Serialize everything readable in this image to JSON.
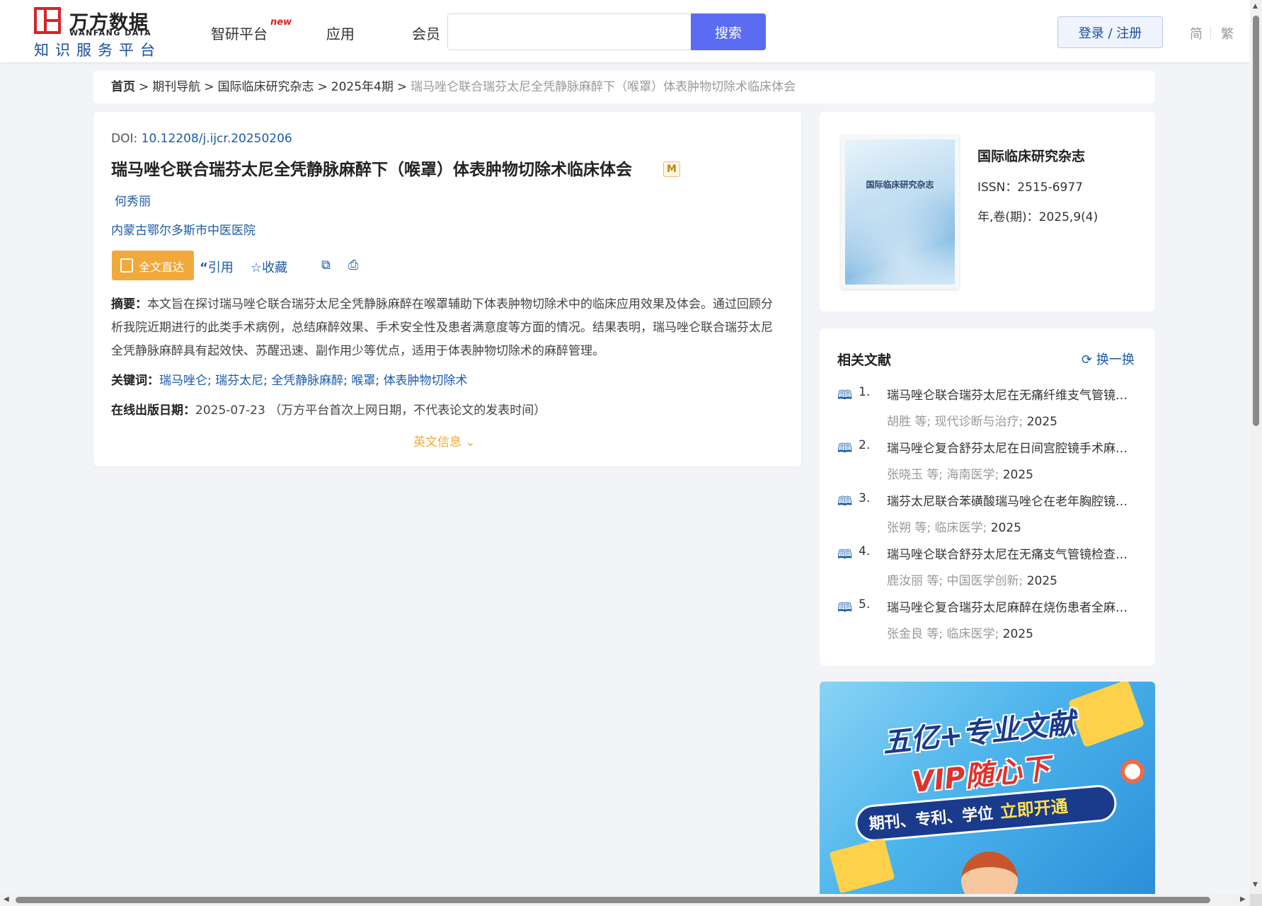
{
  "header": {
    "logo_cn": "万方数据",
    "logo_en": "WANFANG DATA",
    "logo_sub": "知识服务平台",
    "nav": [
      {
        "label": "智研平台",
        "badge": "new"
      },
      {
        "label": "应用"
      },
      {
        "label": "会员"
      }
    ],
    "search": {
      "value": "",
      "placeholder": "",
      "button": "搜索"
    },
    "login": "登录 / 注册",
    "lang_simplified": "简",
    "lang_traditional": "繁"
  },
  "breadcrumb": {
    "items": [
      "首页",
      "期刊导航",
      "国际临床研究杂志",
      "2025年4期"
    ],
    "current": "瑞马唑仑联合瑞芬太尼全凭静脉麻醉下（喉罩）体表肿物切除术临床体会",
    "separator": ">"
  },
  "article": {
    "doi_label": "DOI: ",
    "doi": "10.12208/j.ijcr.20250206",
    "title": "瑞马唑仑联合瑞芬太尼全凭静脉麻醉下（喉罩）体表肿物切除术临床体会",
    "badge": "M",
    "author": "何秀丽",
    "organization": "内蒙古鄂尔多斯市中医医院",
    "actions": {
      "fulltext": "全文直达",
      "cite": "引用",
      "collect": "收藏"
    },
    "abstract_label": "摘要：",
    "abstract": "本文旨在探讨瑞马唑仑联合瑞芬太尼全凭静脉麻醉在喉罩辅助下体表肿物切除术中的临床应用效果及体会。通过回顾分析我院近期进行的此类手术病例，总结麻醉效果、手术安全性及患者满意度等方面的情况。结果表明，瑞马唑仑联合瑞芬太尼全凭静脉麻醉具有起效快、苏醒迅速、副作用少等优点，适用于体表肿物切除术的麻醉管理。",
    "keywords_label": "关键词：",
    "keywords": [
      "瑞马唑仑",
      "瑞芬太尼",
      "全凭静脉麻醉",
      "喉罩",
      "体表肿物切除术"
    ],
    "pubdate_label": "在线出版日期：",
    "pubdate": "2025-07-23",
    "pubdate_note": "（万方平台首次上网日期，不代表论文的发表时间）",
    "english_info": "英文信息"
  },
  "journal": {
    "cover_title": "国际临床研究杂志",
    "name": "国际临床研究杂志",
    "issn": "ISSN：2515-6977",
    "volume": "年,卷(期)：2025,9(4)"
  },
  "related": {
    "title": "相关文献",
    "refresh": "换一换",
    "items": [
      {
        "num": "1.",
        "title": "瑞马唑仑联合瑞芬太尼在无痛纤维支气管镜检查中的应用",
        "author": "胡胜",
        "journal": "现代诊断与治疗",
        "year": "2025"
      },
      {
        "num": "2.",
        "title": "瑞马唑仑复合舒芬太尼在日间宫腔镜手术麻醉中的应用",
        "author": "张晓玉",
        "journal": "海南医学",
        "year": "2025"
      },
      {
        "num": "3.",
        "title": "瑞芬太尼联合苯磺酸瑞马唑仑在老年胸腔镜手术中的应用",
        "author": "张朔",
        "journal": "临床医学",
        "year": "2025"
      },
      {
        "num": "4.",
        "title": "瑞马唑仑联合舒芬太尼在无痛支气管镜检查中的应用",
        "author": "鹿汝丽",
        "journal": "中国医学创新",
        "year": "2025"
      },
      {
        "num": "5.",
        "title": "瑞马唑仑复合瑞芬太尼麻醉在烧伤患者全麻中的应用",
        "author": "张金良",
        "journal": "临床医学",
        "year": "2025"
      }
    ],
    "etal": "等;"
  },
  "banner": {
    "line1": "五亿+专业文献",
    "line2": "VIP随心下",
    "pill": "期刊、专利、学位",
    "pill_highlight": "立即开通"
  }
}
